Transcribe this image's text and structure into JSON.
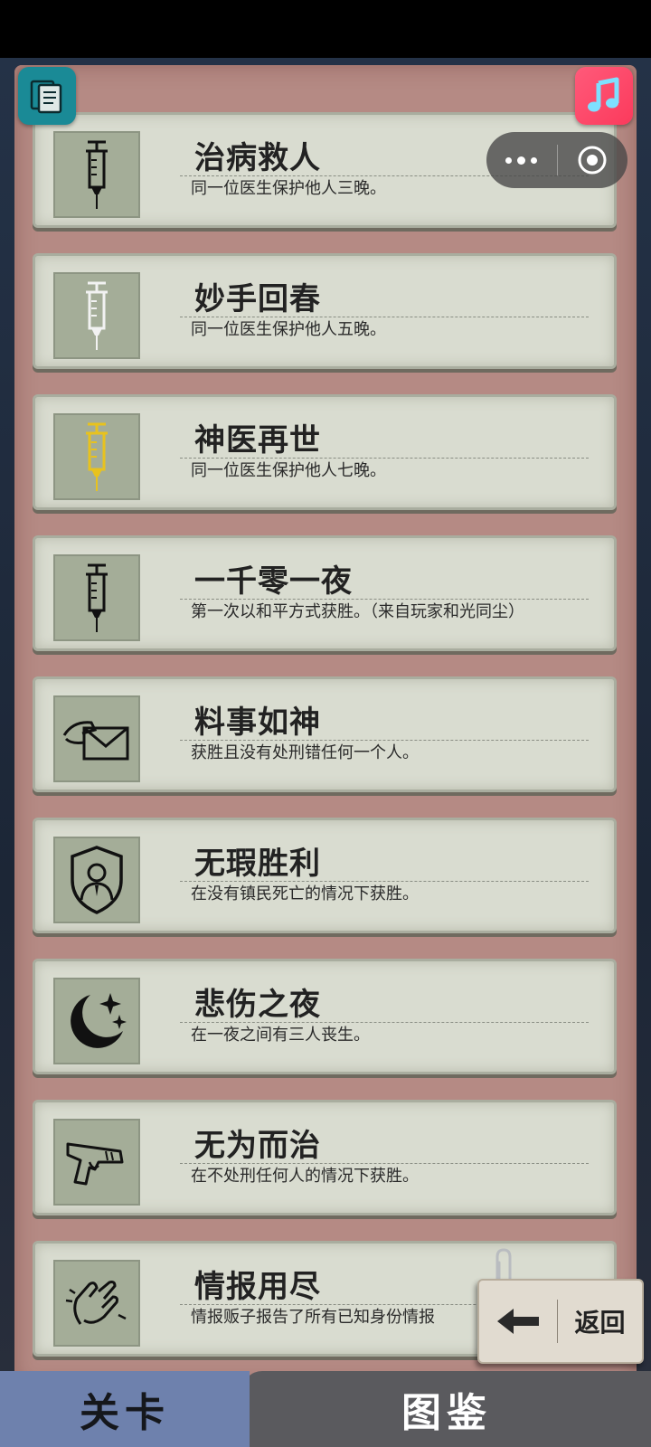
{
  "achievements": [
    {
      "title": "治病救人",
      "desc": "同一位医生保护他人三晚。",
      "icon": "syringe-icon",
      "icon_color": "#111111"
    },
    {
      "title": "妙手回春",
      "desc": "同一位医生保护他人五晚。",
      "icon": "syringe-icon",
      "icon_color": "#f2f2f2"
    },
    {
      "title": "神医再世",
      "desc": "同一位医生保护他人七晚。",
      "icon": "syringe-icon",
      "icon_color": "#e8c21e"
    },
    {
      "title": "一千零一夜",
      "desc": "第一次以和平方式获胜。（来自玩家和光同尘）",
      "icon": "syringe-icon",
      "icon_color": "#111111"
    },
    {
      "title": "料事如神",
      "desc": "获胜且没有处刑错任何一个人。",
      "icon": "hand-envelope-icon",
      "icon_color": "#111111"
    },
    {
      "title": "无瑕胜利",
      "desc": "在没有镇民死亡的情况下获胜。",
      "icon": "shield-person-icon",
      "icon_color": "#111111"
    },
    {
      "title": "悲伤之夜",
      "desc": "在一夜之间有三人丧生。",
      "icon": "moon-stars-icon",
      "icon_color": "#111111"
    },
    {
      "title": "无为而治",
      "desc": "在不处刑任何人的情况下获胜。",
      "icon": "pistol-icon",
      "icon_color": "#111111"
    },
    {
      "title": "情报用尽",
      "desc": "情报贩子报告了所有已知身份情报",
      "icon": "clapping-hands-icon",
      "icon_color": "#111111"
    }
  ],
  "back_button": {
    "label": "返回",
    "icon": "arrow-left-icon"
  },
  "tabs": {
    "active": "关卡",
    "inactive": "图鉴"
  },
  "top_icons": {
    "left": "notes-icon",
    "right": "music-note-icon"
  },
  "capsule": {
    "more": "more-dots-icon",
    "close": "target-icon"
  },
  "colors": {
    "board": "#b58a84",
    "card": "#d9dcd0",
    "tab_active": "#6e81ad",
    "tab_inactive": "#5a5a5e",
    "notes_button": "#1a8a96",
    "music_button": "#fb3a5c"
  }
}
